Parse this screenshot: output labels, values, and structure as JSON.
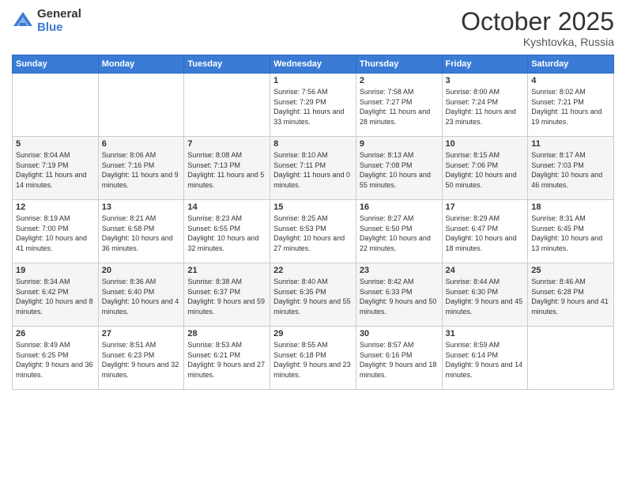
{
  "logo": {
    "general": "General",
    "blue": "Blue"
  },
  "header": {
    "month": "October 2025",
    "location": "Kyshtovka, Russia"
  },
  "weekdays": [
    "Sunday",
    "Monday",
    "Tuesday",
    "Wednesday",
    "Thursday",
    "Friday",
    "Saturday"
  ],
  "weeks": [
    [
      {
        "day": "",
        "sunrise": "",
        "sunset": "",
        "daylight": ""
      },
      {
        "day": "",
        "sunrise": "",
        "sunset": "",
        "daylight": ""
      },
      {
        "day": "",
        "sunrise": "",
        "sunset": "",
        "daylight": ""
      },
      {
        "day": "1",
        "sunrise": "Sunrise: 7:56 AM",
        "sunset": "Sunset: 7:29 PM",
        "daylight": "Daylight: 11 hours and 33 minutes."
      },
      {
        "day": "2",
        "sunrise": "Sunrise: 7:58 AM",
        "sunset": "Sunset: 7:27 PM",
        "daylight": "Daylight: 11 hours and 28 minutes."
      },
      {
        "day": "3",
        "sunrise": "Sunrise: 8:00 AM",
        "sunset": "Sunset: 7:24 PM",
        "daylight": "Daylight: 11 hours and 23 minutes."
      },
      {
        "day": "4",
        "sunrise": "Sunrise: 8:02 AM",
        "sunset": "Sunset: 7:21 PM",
        "daylight": "Daylight: 11 hours and 19 minutes."
      }
    ],
    [
      {
        "day": "5",
        "sunrise": "Sunrise: 8:04 AM",
        "sunset": "Sunset: 7:19 PM",
        "daylight": "Daylight: 11 hours and 14 minutes."
      },
      {
        "day": "6",
        "sunrise": "Sunrise: 8:06 AM",
        "sunset": "Sunset: 7:16 PM",
        "daylight": "Daylight: 11 hours and 9 minutes."
      },
      {
        "day": "7",
        "sunrise": "Sunrise: 8:08 AM",
        "sunset": "Sunset: 7:13 PM",
        "daylight": "Daylight: 11 hours and 5 minutes."
      },
      {
        "day": "8",
        "sunrise": "Sunrise: 8:10 AM",
        "sunset": "Sunset: 7:11 PM",
        "daylight": "Daylight: 11 hours and 0 minutes."
      },
      {
        "day": "9",
        "sunrise": "Sunrise: 8:13 AM",
        "sunset": "Sunset: 7:08 PM",
        "daylight": "Daylight: 10 hours and 55 minutes."
      },
      {
        "day": "10",
        "sunrise": "Sunrise: 8:15 AM",
        "sunset": "Sunset: 7:06 PM",
        "daylight": "Daylight: 10 hours and 50 minutes."
      },
      {
        "day": "11",
        "sunrise": "Sunrise: 8:17 AM",
        "sunset": "Sunset: 7:03 PM",
        "daylight": "Daylight: 10 hours and 46 minutes."
      }
    ],
    [
      {
        "day": "12",
        "sunrise": "Sunrise: 8:19 AM",
        "sunset": "Sunset: 7:00 PM",
        "daylight": "Daylight: 10 hours and 41 minutes."
      },
      {
        "day": "13",
        "sunrise": "Sunrise: 8:21 AM",
        "sunset": "Sunset: 6:58 PM",
        "daylight": "Daylight: 10 hours and 36 minutes."
      },
      {
        "day": "14",
        "sunrise": "Sunrise: 8:23 AM",
        "sunset": "Sunset: 6:55 PM",
        "daylight": "Daylight: 10 hours and 32 minutes."
      },
      {
        "day": "15",
        "sunrise": "Sunrise: 8:25 AM",
        "sunset": "Sunset: 6:53 PM",
        "daylight": "Daylight: 10 hours and 27 minutes."
      },
      {
        "day": "16",
        "sunrise": "Sunrise: 8:27 AM",
        "sunset": "Sunset: 6:50 PM",
        "daylight": "Daylight: 10 hours and 22 minutes."
      },
      {
        "day": "17",
        "sunrise": "Sunrise: 8:29 AM",
        "sunset": "Sunset: 6:47 PM",
        "daylight": "Daylight: 10 hours and 18 minutes."
      },
      {
        "day": "18",
        "sunrise": "Sunrise: 8:31 AM",
        "sunset": "Sunset: 6:45 PM",
        "daylight": "Daylight: 10 hours and 13 minutes."
      }
    ],
    [
      {
        "day": "19",
        "sunrise": "Sunrise: 8:34 AM",
        "sunset": "Sunset: 6:42 PM",
        "daylight": "Daylight: 10 hours and 8 minutes."
      },
      {
        "day": "20",
        "sunrise": "Sunrise: 8:36 AM",
        "sunset": "Sunset: 6:40 PM",
        "daylight": "Daylight: 10 hours and 4 minutes."
      },
      {
        "day": "21",
        "sunrise": "Sunrise: 8:38 AM",
        "sunset": "Sunset: 6:37 PM",
        "daylight": "Daylight: 9 hours and 59 minutes."
      },
      {
        "day": "22",
        "sunrise": "Sunrise: 8:40 AM",
        "sunset": "Sunset: 6:35 PM",
        "daylight": "Daylight: 9 hours and 55 minutes."
      },
      {
        "day": "23",
        "sunrise": "Sunrise: 8:42 AM",
        "sunset": "Sunset: 6:33 PM",
        "daylight": "Daylight: 9 hours and 50 minutes."
      },
      {
        "day": "24",
        "sunrise": "Sunrise: 8:44 AM",
        "sunset": "Sunset: 6:30 PM",
        "daylight": "Daylight: 9 hours and 45 minutes."
      },
      {
        "day": "25",
        "sunrise": "Sunrise: 8:46 AM",
        "sunset": "Sunset: 6:28 PM",
        "daylight": "Daylight: 9 hours and 41 minutes."
      }
    ],
    [
      {
        "day": "26",
        "sunrise": "Sunrise: 8:49 AM",
        "sunset": "Sunset: 6:25 PM",
        "daylight": "Daylight: 9 hours and 36 minutes."
      },
      {
        "day": "27",
        "sunrise": "Sunrise: 8:51 AM",
        "sunset": "Sunset: 6:23 PM",
        "daylight": "Daylight: 9 hours and 32 minutes."
      },
      {
        "day": "28",
        "sunrise": "Sunrise: 8:53 AM",
        "sunset": "Sunset: 6:21 PM",
        "daylight": "Daylight: 9 hours and 27 minutes."
      },
      {
        "day": "29",
        "sunrise": "Sunrise: 8:55 AM",
        "sunset": "Sunset: 6:18 PM",
        "daylight": "Daylight: 9 hours and 23 minutes."
      },
      {
        "day": "30",
        "sunrise": "Sunrise: 8:57 AM",
        "sunset": "Sunset: 6:16 PM",
        "daylight": "Daylight: 9 hours and 18 minutes."
      },
      {
        "day": "31",
        "sunrise": "Sunrise: 8:59 AM",
        "sunset": "Sunset: 6:14 PM",
        "daylight": "Daylight: 9 hours and 14 minutes."
      },
      {
        "day": "",
        "sunrise": "",
        "sunset": "",
        "daylight": ""
      }
    ]
  ]
}
